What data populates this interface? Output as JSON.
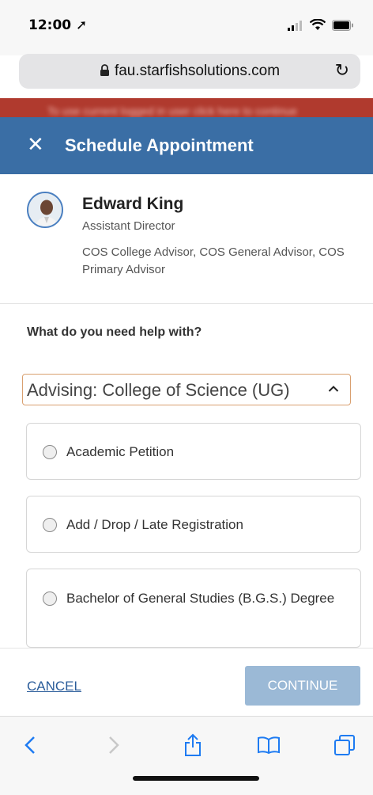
{
  "status": {
    "time": "12:00"
  },
  "browser": {
    "url": "fau.starfishsolutions.com"
  },
  "banner": {
    "text": "To use current logged in user click here to continue"
  },
  "header": {
    "title": "Schedule Appointment"
  },
  "advisor": {
    "name": "Edward King",
    "title": "Assistant Director",
    "roles": "COS College Advisor, COS General Advisor, COS Primary Advisor"
  },
  "form": {
    "question": "What do you need help with?",
    "selected_category": "Advising: College of Science (UG)",
    "options": [
      {
        "label": "Academic Petition"
      },
      {
        "label": "Add / Drop / Late Registration"
      },
      {
        "label": "Bachelor of General Studies (B.G.S.) Degree"
      }
    ]
  },
  "footer": {
    "cancel_label": "CANCEL",
    "continue_label": "CONTINUE"
  },
  "colors": {
    "header": "#3a6ea5",
    "banner": "#b03a2e",
    "continue_disabled": "#9bb9d6",
    "link": "#2a5c9a"
  }
}
